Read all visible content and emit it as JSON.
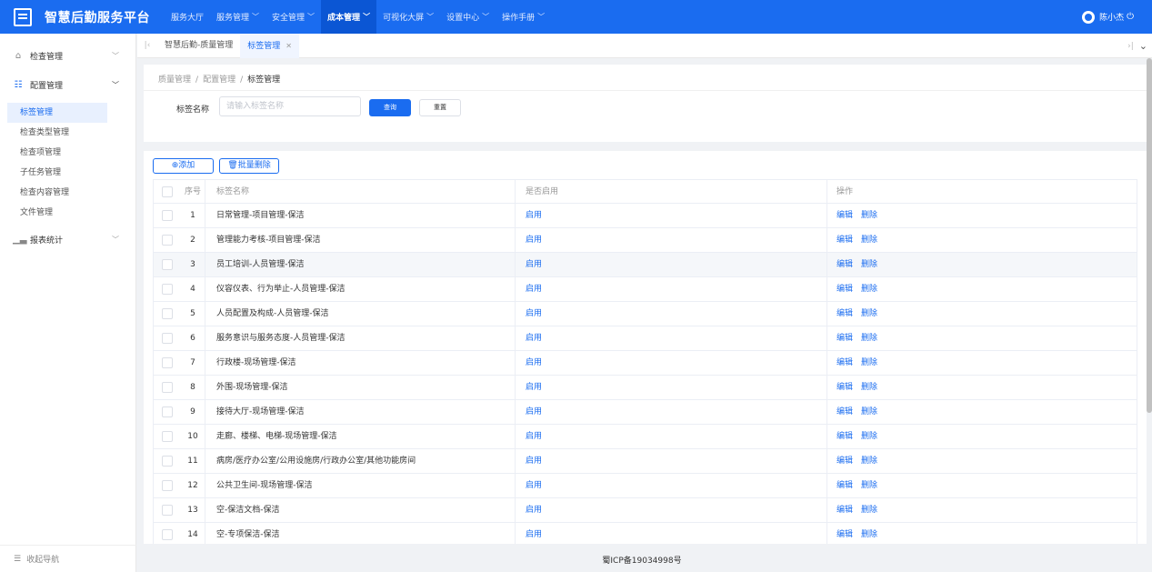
{
  "header": {
    "app_title": "智慧后勤服务平台",
    "nav": [
      {
        "label": "服务大厅",
        "has_caret": false,
        "active": false
      },
      {
        "label": "服务管理",
        "has_caret": true,
        "active": false
      },
      {
        "label": "安全管理",
        "has_caret": true,
        "active": false
      },
      {
        "label": "成本管理",
        "has_caret": true,
        "active": true
      },
      {
        "label": "可视化大屏",
        "has_caret": true,
        "active": false
      },
      {
        "label": "设置中心",
        "has_caret": true,
        "active": false
      },
      {
        "label": "操作手册",
        "has_caret": true,
        "active": false
      }
    ],
    "user_name": "陈小杰"
  },
  "sidebar": {
    "groups": [
      {
        "label": "检查管理",
        "icon": "home-icon",
        "expanded": false
      },
      {
        "label": "配置管理",
        "icon": "grid-icon",
        "expanded": true
      },
      {
        "label": "报表统计",
        "icon": "chart-icon",
        "expanded": false
      }
    ],
    "config_items": [
      "标签管理",
      "检查类型管理",
      "检查项管理",
      "子任务管理",
      "检查内容管理",
      "文件管理"
    ],
    "active_item": "标签管理",
    "collapse_label": "收起导航"
  },
  "tabs": {
    "items": [
      {
        "label": "智慧后勤-质量管理",
        "active": false,
        "closable": false
      },
      {
        "label": "标签管理",
        "active": true,
        "closable": true
      }
    ]
  },
  "breadcrumb": [
    "质量管理",
    "配置管理",
    "标签管理"
  ],
  "search": {
    "label": "标签名称",
    "value": "",
    "placeholder": "请输入标签名称",
    "query_label": "查询",
    "reset_label": "重置"
  },
  "toolbar": {
    "add_label": "添加",
    "batch_delete_label": "批量删除"
  },
  "table": {
    "columns": [
      "序号",
      "标签名称",
      "是否启用",
      "操作"
    ],
    "edit_label": "编辑",
    "delete_label": "删除",
    "hover_row": 3,
    "rows": [
      {
        "index": "1",
        "name": "日常管理-项目管理-保洁",
        "enabled": "启用"
      },
      {
        "index": "2",
        "name": "管理能力考核-项目管理-保洁",
        "enabled": "启用"
      },
      {
        "index": "3",
        "name": "员工培训-人员管理-保洁",
        "enabled": "启用"
      },
      {
        "index": "4",
        "name": "仪容仪表、行为举止-人员管理-保洁",
        "enabled": "启用"
      },
      {
        "index": "5",
        "name": "人员配置及构成-人员管理-保洁",
        "enabled": "启用"
      },
      {
        "index": "6",
        "name": "服务意识与服务态度-人员管理-保洁",
        "enabled": "启用"
      },
      {
        "index": "7",
        "name": "行政楼-现场管理-保洁",
        "enabled": "启用"
      },
      {
        "index": "8",
        "name": "外围-现场管理-保洁",
        "enabled": "启用"
      },
      {
        "index": "9",
        "name": "接待大厅-现场管理-保洁",
        "enabled": "启用"
      },
      {
        "index": "10",
        "name": "走廊、楼梯、电梯-现场管理-保洁",
        "enabled": "启用"
      },
      {
        "index": "11",
        "name": "病房/医疗办公室/公用设施房/行政办公室/其他功能房间",
        "enabled": "启用"
      },
      {
        "index": "12",
        "name": "公共卫生间-现场管理-保洁",
        "enabled": "启用"
      },
      {
        "index": "13",
        "name": "空-保洁文档-保洁",
        "enabled": "启用"
      },
      {
        "index": "14",
        "name": "空-专项保洁-保洁",
        "enabled": "启用"
      }
    ]
  },
  "footer": {
    "icp": "蜀ICP备19034998号"
  },
  "colors": {
    "primary": "#1a6cf0",
    "header_bg": "#1a6cf0",
    "active_nav_bg": "#0b56d4"
  }
}
